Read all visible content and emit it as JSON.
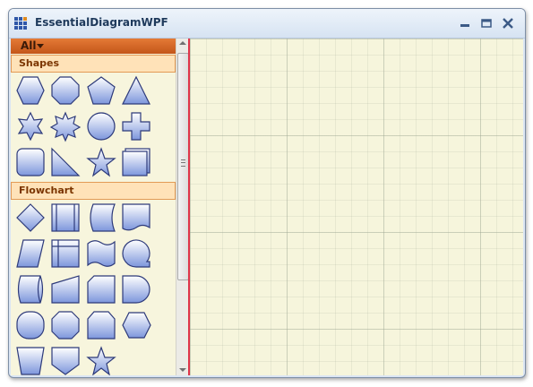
{
  "window": {
    "title": "EssentialDiagramWPF",
    "controls": {
      "minimize_icon": "minimize-icon",
      "maximize_icon": "maximize-icon",
      "close_icon": "close-icon"
    }
  },
  "palette": {
    "filter_label": "All",
    "sections": [
      {
        "label": "Shapes",
        "items": [
          "hexagon",
          "octagon",
          "pentagon",
          "triangle",
          "star-6-point",
          "star-7-point",
          "circle",
          "plus",
          "rounded-rectangle",
          "right-triangle",
          "star-5-point",
          "stacked-rectangle"
        ]
      },
      {
        "label": "Flowchart",
        "items": [
          "decision",
          "predefined-process",
          "stored-data",
          "document",
          "data",
          "internal-storage",
          "punched-tape",
          "sequential-access-storage",
          "direct-access-storage",
          "manual-input",
          "card",
          "delay",
          "terminator",
          "preparation",
          "off-page-connector",
          "display",
          "manual-operation",
          "off-page-reference",
          "star"
        ]
      }
    ]
  },
  "colors": {
    "shape_fill_top": "#ffffff",
    "shape_fill_bottom": "#7d96dc",
    "shape_stroke": "#2d3a7a",
    "header_accent": "#d4672a",
    "section_fill": "#ffe2b8",
    "canvas_bg": "#f6f5dc",
    "scrollbar_border": "#e0344a"
  }
}
